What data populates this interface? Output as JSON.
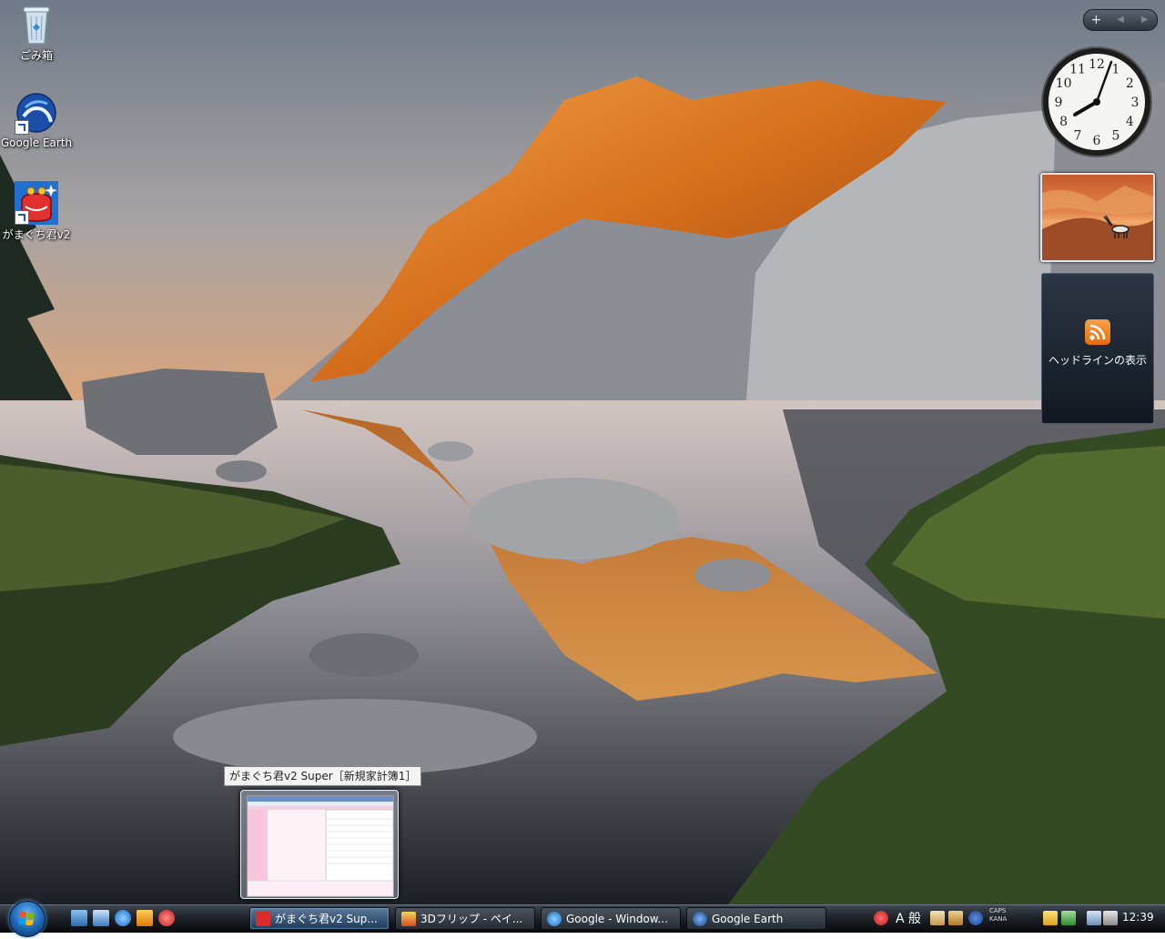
{
  "desktop": {
    "icons": [
      {
        "label": "ごみ箱",
        "icon": "recycle-bin-icon"
      },
      {
        "label": "Google Earth",
        "icon": "google-earth-icon"
      },
      {
        "label": "がまぐち君v2",
        "icon": "gamaguchi-purse-icon"
      }
    ]
  },
  "sidebar": {
    "controls": {
      "add": "+",
      "prev": "◀",
      "next": "▶"
    },
    "clock": {
      "numerals": [
        "12",
        "1",
        "2",
        "3",
        "4",
        "5",
        "6",
        "7",
        "8",
        "9",
        "10",
        "11"
      ],
      "time_shown": "12:39"
    },
    "feed_gadget": {
      "label": "ヘッドラインの表示",
      "icon": "rss-feed-icon"
    }
  },
  "taskbar_preview": {
    "tooltip": "がまぐち君v2 Super［新規家計簿1］"
  },
  "taskbar": {
    "quick_launch": [
      "show-desktop-icon",
      "switch-windows-icon",
      "internet-explorer-icon",
      "media-player-icon",
      "gamaguchi-launch-icon"
    ],
    "buttons": [
      {
        "label": "がまぐち君v2 Sup...",
        "icon": "gamaguchi-purse-icon",
        "active": true
      },
      {
        "label": "3Dフリップ - ペイ...",
        "icon": "paint-icon",
        "active": false
      },
      {
        "label": "Google - Window...",
        "icon": "internet-explorer-icon",
        "active": false
      },
      {
        "label": "Google Earth",
        "icon": "google-earth-icon",
        "active": false
      }
    ],
    "tray": {
      "ime_mode": "A 般",
      "caps": "CAPS",
      "kana": "KANA",
      "clock": "12:39"
    }
  },
  "colors": {
    "taskbar": "#1b1f25",
    "active_task": "#3b5d80",
    "accent": "#1a64b4"
  }
}
